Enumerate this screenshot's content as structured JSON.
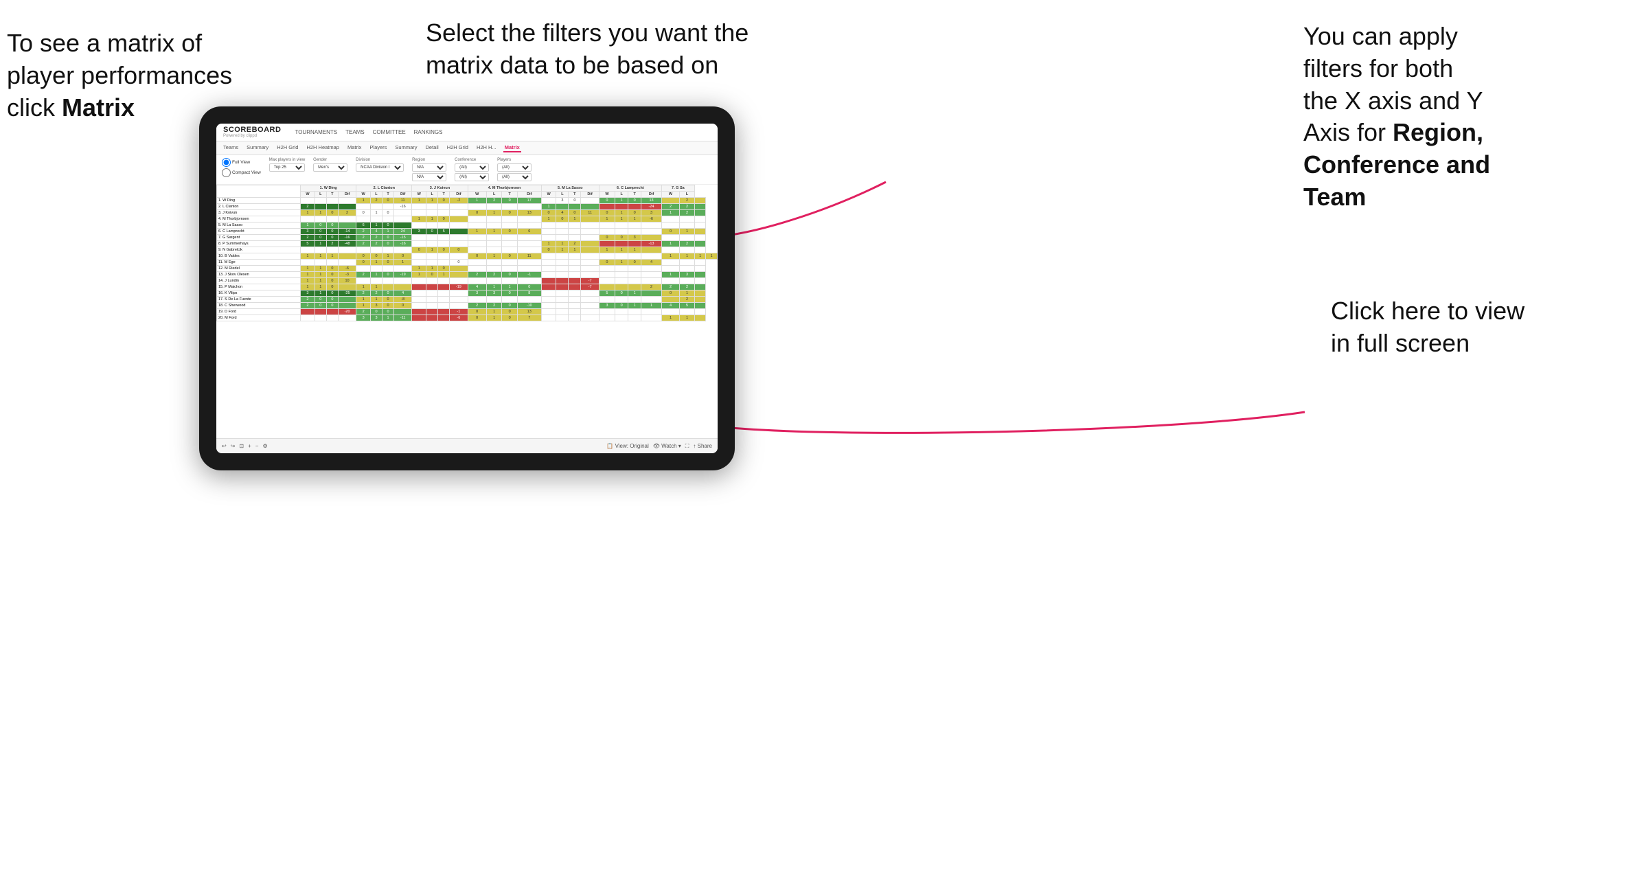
{
  "annotations": {
    "left": {
      "line1": "To see a matrix of",
      "line2": "player performances",
      "line3_normal": "click ",
      "line3_bold": "Matrix"
    },
    "center": {
      "line1": "Select the filters you want the",
      "line2": "matrix data to be based on"
    },
    "right_top": {
      "line1": "You  can apply",
      "line2": "filters for both",
      "line3": "the X axis and Y",
      "line4_normal": "Axis for ",
      "line4_bold": "Region,",
      "line5_bold": "Conference and",
      "line6_bold": "Team"
    },
    "right_bottom": {
      "line1": "Click here to view",
      "line2": "in full screen"
    }
  },
  "app": {
    "logo_main": "SCOREBOARD",
    "logo_sub": "Powered by clippd",
    "nav_items": [
      "TOURNAMENTS",
      "TEAMS",
      "COMMITTEE",
      "RANKINGS"
    ]
  },
  "sub_nav": {
    "tabs": [
      "Teams",
      "Summary",
      "H2H Grid",
      "H2H Heatmap",
      "Matrix",
      "Players",
      "Summary",
      "Detail",
      "H2H Grid",
      "H2H H...",
      "Matrix"
    ],
    "active_index": 10
  },
  "filters": {
    "view_options": [
      "Full View",
      "Compact View"
    ],
    "active_view": "Full View",
    "max_players_label": "Max players in view",
    "max_players_value": "Top 25",
    "gender_label": "Gender",
    "gender_value": "Men's",
    "division_label": "Division",
    "division_value": "NCAA Division I",
    "region_label": "Region",
    "region_value": "N/A",
    "conference_label": "Conference",
    "conference_value": "(All)",
    "players_label": "Players",
    "players_value": "(All)"
  },
  "matrix": {
    "col_headers": [
      "1. W Ding",
      "2. L Clanton",
      "3. J Koivun",
      "4. M Thorbjornsen",
      "5. M La Sasso",
      "6. C Lamprecht",
      "7. G Sa"
    ],
    "sub_headers": [
      "W",
      "L",
      "T",
      "Dif"
    ],
    "rows": [
      {
        "name": "1. W Ding",
        "cells": [
          [
            "",
            "",
            "",
            ""
          ],
          [
            "1",
            "2",
            "0",
            "11"
          ],
          [
            "1",
            "1",
            "0",
            "-2"
          ],
          [
            "1",
            "2",
            "0",
            "17"
          ],
          [
            "",
            "3",
            "0",
            ""
          ],
          [
            "0",
            "1",
            "0",
            "13"
          ],
          [
            "",
            "2",
            ""
          ]
        ]
      },
      {
        "name": "2. L Clanton",
        "cells": [
          [
            "2",
            "",
            "",
            ""
          ],
          [
            "",
            "",
            "",
            "-16"
          ],
          [
            "",
            "",
            "",
            ""
          ],
          [
            "",
            "",
            "",
            ""
          ],
          [
            "1",
            "",
            "",
            ""
          ],
          [
            "",
            "",
            "",
            "-24"
          ],
          [
            "2",
            "2",
            ""
          ]
        ]
      },
      {
        "name": "3. J Koivun",
        "cells": [
          [
            "1",
            "1",
            "0",
            "2"
          ],
          [
            "0",
            "1",
            "0",
            ""
          ],
          [
            "",
            "",
            "",
            ""
          ],
          [
            "0",
            "1",
            "0",
            "13"
          ],
          [
            "0",
            "4",
            "0",
            "11"
          ],
          [
            "0",
            "1",
            "0",
            "3"
          ],
          [
            "1",
            "2",
            ""
          ]
        ]
      },
      {
        "name": "4. M Thorbjornsen",
        "cells": [
          [
            "",
            "",
            "",
            ""
          ],
          [
            "",
            "",
            "",
            ""
          ],
          [
            "1",
            "1",
            "0",
            ""
          ],
          [
            "",
            "",
            "",
            ""
          ],
          [
            "1",
            "0",
            "1",
            ""
          ],
          [
            "1",
            "1",
            "1",
            "-6"
          ],
          [
            "",
            "",
            ""
          ]
        ]
      },
      {
        "name": "5. M La Sasso",
        "cells": [
          [
            "1",
            "0",
            "0",
            ""
          ],
          [
            "6",
            "1",
            "0",
            ""
          ],
          [
            "",
            "",
            "",
            ""
          ],
          [
            "",
            "",
            "",
            ""
          ],
          [
            "",
            "",
            "",
            ""
          ],
          [
            "",
            "",
            "",
            ""
          ],
          [
            "",
            "",
            ""
          ]
        ]
      },
      {
        "name": "6. C Lamprecht",
        "cells": [
          [
            "3",
            "0",
            "0",
            "-14"
          ],
          [
            "2",
            "4",
            "1",
            "24"
          ],
          [
            "3",
            "0",
            "5",
            ""
          ],
          [
            "1",
            "1",
            "0",
            "6"
          ],
          [
            "",
            "",
            "",
            ""
          ],
          [
            "",
            "",
            "",
            ""
          ],
          [
            "0",
            "1",
            ""
          ]
        ]
      },
      {
        "name": "7. G Sargent",
        "cells": [
          [
            "2",
            "0",
            "0",
            "-16"
          ],
          [
            "2",
            "2",
            "0",
            "-15"
          ],
          [
            "",
            "",
            "",
            ""
          ],
          [
            "",
            "",
            "",
            ""
          ],
          [
            "",
            "",
            "",
            ""
          ],
          [
            "0",
            "0",
            "3",
            ""
          ],
          [
            "",
            "",
            ""
          ]
        ]
      },
      {
        "name": "8. P Summerhays",
        "cells": [
          [
            "5",
            "1",
            "2",
            "-48"
          ],
          [
            "2",
            "2",
            "0",
            "-16"
          ],
          [
            "",
            "",
            "",
            ""
          ],
          [
            "",
            "",
            "",
            ""
          ],
          [
            "1",
            "1",
            "2",
            ""
          ],
          [
            "",
            "",
            "",
            "-13"
          ],
          [
            "1",
            "2",
            ""
          ]
        ]
      },
      {
        "name": "9. N Gabrelcik",
        "cells": [
          [
            "",
            "",
            "",
            ""
          ],
          [
            "",
            "",
            "",
            ""
          ],
          [
            "0",
            "1",
            "0",
            "0"
          ],
          [
            "",
            "",
            "",
            ""
          ],
          [
            "0",
            "1",
            "1",
            ""
          ],
          [
            "1",
            "1",
            "1",
            ""
          ],
          [
            "",
            "",
            ""
          ]
        ]
      },
      {
        "name": "10. B Valdes",
        "cells": [
          [
            "1",
            "1",
            "1",
            ""
          ],
          [
            "0",
            "0",
            "1",
            "0"
          ],
          [
            "",
            "",
            "",
            ""
          ],
          [
            "0",
            "1",
            "0",
            "11"
          ],
          [
            "",
            "",
            "",
            ""
          ],
          [
            "",
            "",
            "",
            ""
          ],
          [
            "1",
            "1",
            "1",
            "1"
          ]
        ]
      },
      {
        "name": "11. M Ege",
        "cells": [
          [
            "",
            "",
            "",
            ""
          ],
          [
            "0",
            "1",
            "0",
            "1"
          ],
          [
            "",
            "",
            "",
            "0"
          ],
          [
            "",
            "",
            "",
            ""
          ],
          [
            "",
            "",
            "",
            ""
          ],
          [
            "0",
            "1",
            "0",
            "4"
          ],
          [
            "",
            "",
            ""
          ]
        ]
      },
      {
        "name": "12. M Riedel",
        "cells": [
          [
            "1",
            "1",
            "0",
            "-6"
          ],
          [
            "",
            "",
            "",
            ""
          ],
          [
            "1",
            "1",
            "0",
            ""
          ],
          [
            "",
            "",
            "",
            ""
          ],
          [
            "",
            "",
            "",
            ""
          ],
          [
            "",
            "",
            "",
            ""
          ],
          [
            "",
            "",
            ""
          ]
        ]
      },
      {
        "name": "13. J Skov Olesen",
        "cells": [
          [
            "1",
            "1",
            "0",
            "-3"
          ],
          [
            "2",
            "1",
            "0",
            "-19"
          ],
          [
            "1",
            "0",
            "1",
            ""
          ],
          [
            "2",
            "2",
            "0",
            "-1"
          ],
          [
            "",
            "",
            "",
            ""
          ],
          [
            "",
            "",
            "",
            ""
          ],
          [
            "1",
            "3",
            ""
          ]
        ]
      },
      {
        "name": "14. J Lundin",
        "cells": [
          [
            "1",
            "1",
            "0",
            "10"
          ],
          [
            "",
            "",
            "",
            ""
          ],
          [
            "",
            "",
            "",
            ""
          ],
          [
            "",
            "",
            "",
            ""
          ],
          [
            "",
            "",
            "",
            "-7"
          ],
          [
            "",
            "",
            "",
            ""
          ],
          [
            "",
            "",
            ""
          ]
        ]
      },
      {
        "name": "15. P Maichon",
        "cells": [
          [
            "1",
            "1",
            "0",
            ""
          ],
          [
            "1",
            "1",
            "",
            ""
          ],
          [
            "",
            "",
            "",
            "-19"
          ],
          [
            "4",
            "1",
            "1",
            "0"
          ],
          [
            "",
            "",
            "",
            "-7"
          ],
          [
            "",
            "",
            "",
            "2"
          ],
          [
            "2",
            "2",
            ""
          ]
        ]
      },
      {
        "name": "16. K Vilips",
        "cells": [
          [
            "3",
            "1",
            "0",
            "-25"
          ],
          [
            "2",
            "2",
            "0",
            "4"
          ],
          [
            "",
            "",
            "",
            ""
          ],
          [
            "3",
            "3",
            "0",
            "8"
          ],
          [
            "",
            "",
            "",
            ""
          ],
          [
            "5",
            "0",
            "1",
            ""
          ],
          [
            "0",
            "1",
            ""
          ]
        ]
      },
      {
        "name": "17. S De La Fuente",
        "cells": [
          [
            "2",
            "0",
            "0",
            ""
          ],
          [
            "1",
            "1",
            "0",
            "-8"
          ],
          [
            "",
            "",
            "",
            ""
          ],
          [
            "",
            "",
            "",
            ""
          ],
          [
            "",
            "",
            "",
            ""
          ],
          [
            "",
            "",
            "",
            ""
          ],
          [
            "",
            "2",
            ""
          ]
        ]
      },
      {
        "name": "18. C Sherwood",
        "cells": [
          [
            "2",
            "0",
            "0",
            ""
          ],
          [
            "1",
            "3",
            "0",
            "0"
          ],
          [
            "",
            "",
            "",
            ""
          ],
          [
            "2",
            "2",
            "0",
            "-10"
          ],
          [
            "",
            "",
            "",
            ""
          ],
          [
            "3",
            "0",
            "1",
            "1"
          ],
          [
            "4",
            "5",
            ""
          ]
        ]
      },
      {
        "name": "19. D Ford",
        "cells": [
          [
            "",
            "",
            "",
            "-20"
          ],
          [
            "2",
            "0",
            "0",
            ""
          ],
          [
            "",
            "",
            "",
            "-1"
          ],
          [
            "0",
            "1",
            "0",
            "13"
          ],
          [
            "",
            "",
            "",
            ""
          ],
          [
            "",
            "",
            "",
            ""
          ],
          [
            "",
            "",
            ""
          ]
        ]
      },
      {
        "name": "20. M Ford",
        "cells": [
          [
            "",
            "",
            "",
            ""
          ],
          [
            "3",
            "3",
            "1",
            "-11"
          ],
          [
            "",
            "",
            "",
            "-6"
          ],
          [
            "0",
            "1",
            "0",
            "7"
          ],
          [
            "",
            "",
            "",
            ""
          ],
          [
            "",
            "",
            "",
            ""
          ],
          [
            "1",
            "1",
            ""
          ]
        ]
      }
    ]
  },
  "bottom_toolbar": {
    "view_original": "View: Original",
    "watch": "Watch",
    "share": "Share"
  }
}
